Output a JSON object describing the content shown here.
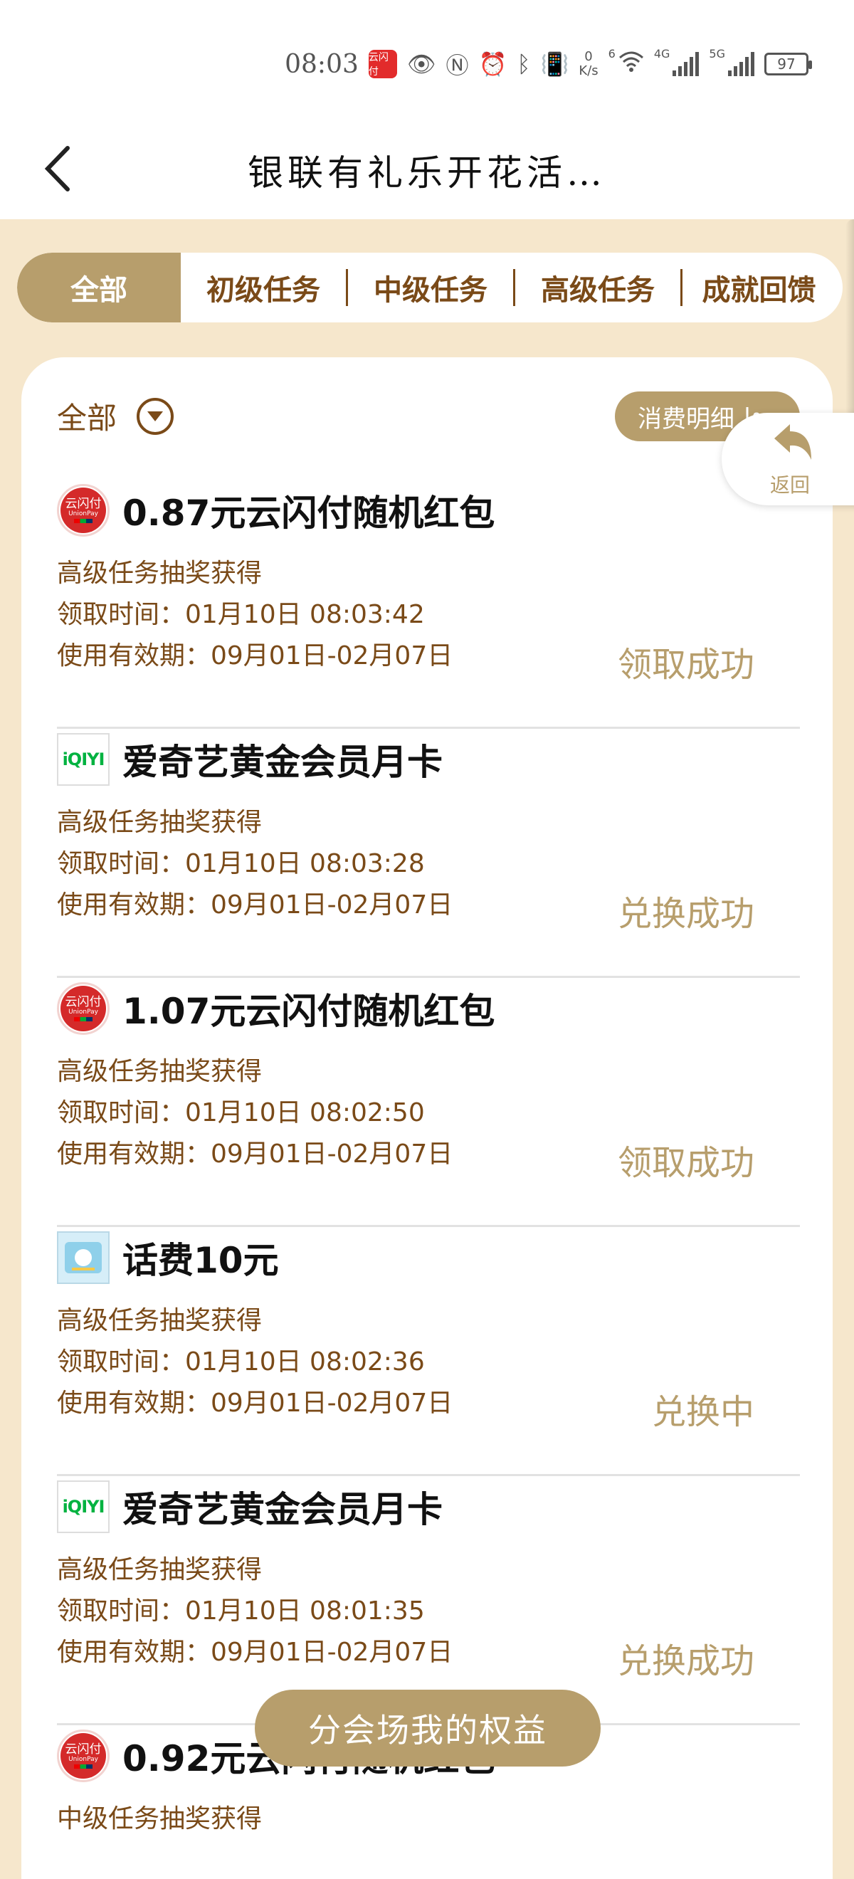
{
  "status_bar": {
    "time": "08:03",
    "net_speed_value": "0",
    "net_speed_unit": "K/s",
    "net1": "4G",
    "net2": "5G",
    "wifi_badge": "6",
    "battery": "97",
    "app_icon_text": "云闪付"
  },
  "header": {
    "title": "银联有礼乐开花活…"
  },
  "tabs": [
    "全部",
    "初级任务",
    "中级任务",
    "高级任务",
    "成就回馈"
  ],
  "filter": {
    "label": "全部",
    "detail_button": "消费明细"
  },
  "return_bubble": {
    "label": "返回"
  },
  "items": [
    {
      "logo": "unionpay",
      "title": "0.87元云闪付随机红包",
      "source": "高级任务抽奖获得",
      "claim_time": "领取时间：01月10日 08:03:42",
      "validity": "使用有效期：09月01日-02月07日",
      "status": "领取成功"
    },
    {
      "logo": "iqiyi",
      "title": "爱奇艺黄金会员月卡",
      "source": "高级任务抽奖获得",
      "claim_time": "领取时间：01月10日 08:03:28",
      "validity": "使用有效期：09月01日-02月07日",
      "status": "兑换成功"
    },
    {
      "logo": "unionpay",
      "title": "1.07元云闪付随机红包",
      "source": "高级任务抽奖获得",
      "claim_time": "领取时间：01月10日 08:02:50",
      "validity": "使用有效期：09月01日-02月07日",
      "status": "领取成功"
    },
    {
      "logo": "phone",
      "title": "话费10元",
      "source": "高级任务抽奖获得",
      "claim_time": "领取时间：01月10日 08:02:36",
      "validity": "使用有效期：09月01日-02月07日",
      "status": "兑换中"
    },
    {
      "logo": "iqiyi",
      "title": "爱奇艺黄金会员月卡",
      "source": "高级任务抽奖获得",
      "claim_time": "领取时间：01月10日 08:01:35",
      "validity": "使用有效期：09月01日-02月07日",
      "status": "兑换成功"
    },
    {
      "logo": "unionpay",
      "title": "0.92元云闪付随机红包",
      "source": "中级任务抽奖获得",
      "claim_time": "",
      "validity": "",
      "status": ""
    }
  ],
  "logos": {
    "unionpay_line1": "云闪付",
    "unionpay_line2": "UnionPay",
    "iqiyi": "iQIYI"
  },
  "float_button": "分会场我的权益",
  "colors": {
    "accent": "#b79e6c",
    "brown_text": "#7a4a18",
    "page_bg": "#f6e7cc"
  }
}
